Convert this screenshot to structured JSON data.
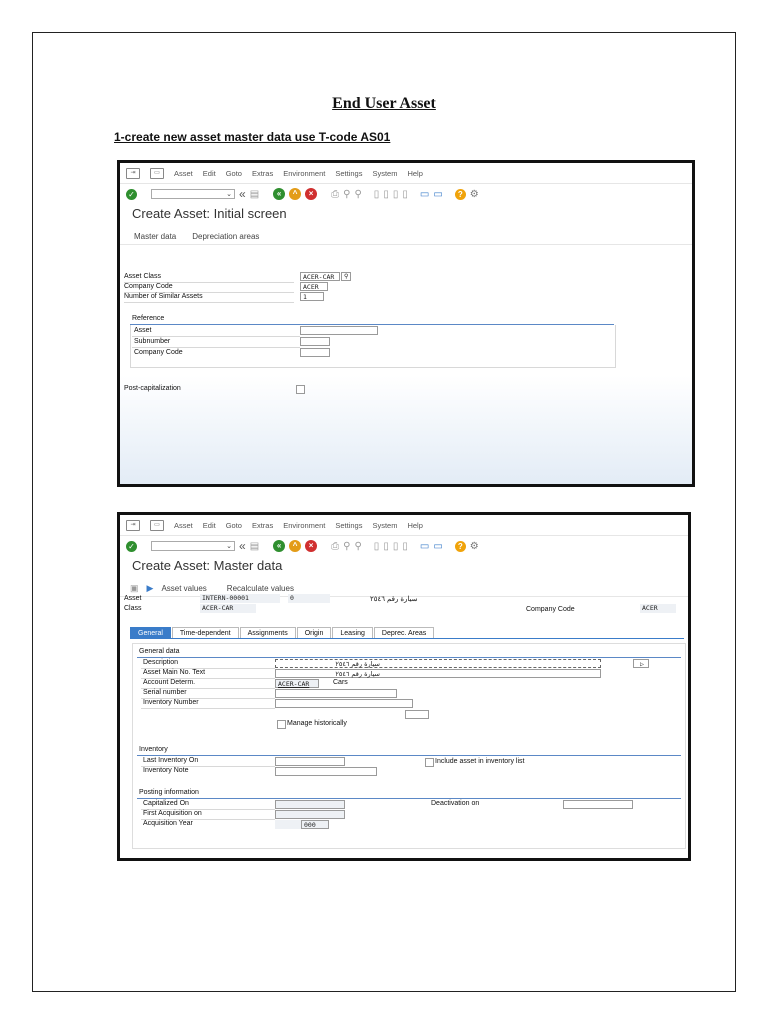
{
  "doc": {
    "title": "End User Asset",
    "step1": "1-create new asset master data use T-code AS01"
  },
  "menu": {
    "items": [
      "Asset",
      "Edit",
      "Goto",
      "Extras",
      "Environment",
      "Settings",
      "System",
      "Help"
    ]
  },
  "screen1": {
    "title": "Create Asset:  Initial screen",
    "app_buttons": [
      "Master data",
      "Depreciation areas"
    ],
    "asset_class_label": "Asset Class",
    "asset_class_value": "ACER-CAR",
    "company_code_label": "Company Code",
    "company_code_value": "ACER",
    "similar_label": "Number of Similar Assets",
    "similar_value": "1",
    "reference_title": "Reference",
    "ref_asset": "Asset",
    "ref_subnumber": "Subnumber",
    "ref_company": "Company Code",
    "post_cap": "Post-capitalization"
  },
  "screen2": {
    "title": "Create Asset:  Master data",
    "app_buttons": [
      "Asset values",
      "Recalculate values"
    ],
    "asset_label": "Asset",
    "asset_value": "INTERN-00001",
    "asset_sub": "0",
    "asset_desc": "سيارة رقم ٢٥٤٦",
    "class_label": "Class",
    "class_value": "ACER-CAR",
    "cc_label": "Company Code",
    "cc_value": "ACER",
    "tabs": [
      "General",
      "Time-dependent",
      "Assignments",
      "Origin",
      "Leasing",
      "Deprec. Areas"
    ],
    "general_title": "General data",
    "description_label": "Description",
    "description_value": "سيارة رقم ٢٥٤٦",
    "main_text_label": "Asset Main No. Text",
    "main_text_value": "سيارة رقم ٢٥٤٦",
    "acct_label": "Account Determ.",
    "acct_value": "ACER-CAR",
    "acct_text": "Cars",
    "serial_label": "Serial number",
    "inv_no_label": "Inventory Number",
    "manage_hist": "Manage historically",
    "inventory_title": "Inventory",
    "last_inv_label": "Last Inventory On",
    "include_inv": "Include asset in inventory list",
    "inv_note_label": "Inventory Note",
    "posting_title": "Posting information",
    "cap_on_label": "Capitalized On",
    "deact_label": "Deactivation on",
    "first_acq_label": "First Acquisition on",
    "acq_year_label": "Acquisition Year",
    "acq_year_value": "000"
  },
  "colors": {
    "accent": "#3a7cc9",
    "ok": "#2f8f2f",
    "back": "#2f8f2f",
    "exit": "#e39c18",
    "cancel": "#d02f2f",
    "help": "#f0a30a"
  }
}
